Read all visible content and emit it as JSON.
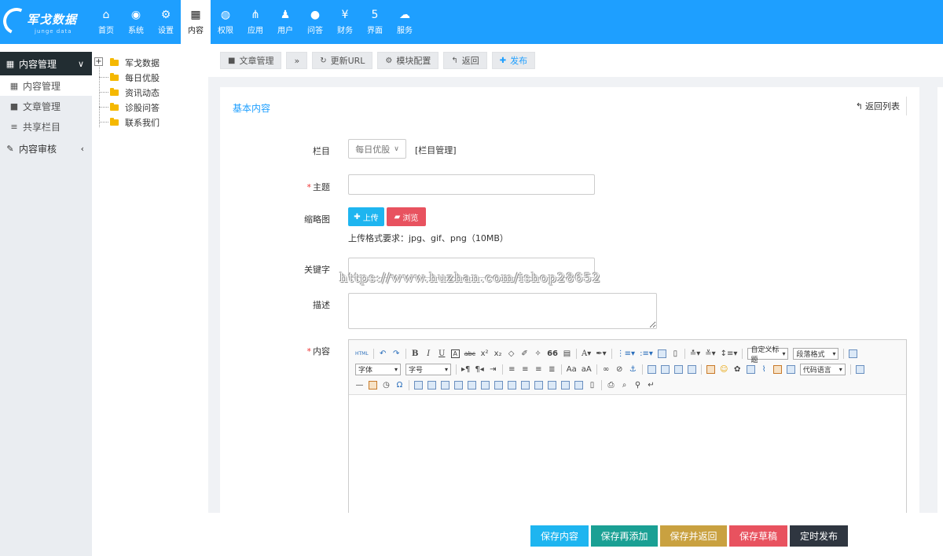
{
  "logo": {
    "title": "军戈数据",
    "subtitle": "junge data"
  },
  "nav": [
    {
      "label": "首页",
      "icon": "home-icon",
      "glyph": "⌂"
    },
    {
      "label": "系统",
      "icon": "globe-icon",
      "glyph": "◉"
    },
    {
      "label": "设置",
      "icon": "gears-icon",
      "glyph": "⚙"
    },
    {
      "label": "内容",
      "icon": "grid-icon",
      "glyph": "▦",
      "active": true
    },
    {
      "label": "权限",
      "icon": "user-circle-icon",
      "glyph": "◍"
    },
    {
      "label": "应用",
      "icon": "sitemap-icon",
      "glyph": "⋔"
    },
    {
      "label": "用户",
      "icon": "user-icon",
      "glyph": "♟"
    },
    {
      "label": "问答",
      "icon": "chat-icon",
      "glyph": "●"
    },
    {
      "label": "财务",
      "icon": "yen-icon",
      "glyph": "¥"
    },
    {
      "label": "界面",
      "icon": "html5-icon",
      "glyph": "5"
    },
    {
      "label": "服务",
      "icon": "cloud-icon",
      "glyph": "☁"
    }
  ],
  "sidebar": {
    "groups": [
      {
        "label": "内容管理",
        "icon": "grid-icon",
        "glyph": "▦",
        "arrow": "∨",
        "active": true
      },
      {
        "label": "内容审核",
        "icon": "edit-icon",
        "glyph": "✎",
        "arrow": "‹"
      }
    ],
    "items": [
      {
        "label": "内容管理",
        "icon": "grid-icon",
        "glyph": "▦",
        "active": true
      },
      {
        "label": "文章管理",
        "icon": "note-icon",
        "glyph": "■"
      },
      {
        "label": "共享栏目",
        "icon": "list-icon",
        "glyph": "≡"
      }
    ]
  },
  "tree": {
    "expander": "+",
    "root": "军戈数据",
    "children": [
      "每日优股",
      "资讯动态",
      "诊股问答",
      "联系我们"
    ]
  },
  "toolbar": {
    "article_manage": "文章管理",
    "more": "»",
    "refresh_url": "更新URL",
    "module_config": "模块配置",
    "back": "返回",
    "publish": "发布"
  },
  "panel": {
    "title": "基本内容",
    "back_list": "返回列表"
  },
  "form": {
    "column_label": "栏目",
    "column_value": "每日优股",
    "column_link": "[栏目管理]",
    "subject_label": "主题",
    "subject_value": "",
    "thumbnail_label": "缩略图",
    "upload_label": "上传",
    "browse_label": "浏览",
    "upload_hint": "上传格式要求：jpg、gif、png（10MB）",
    "keywords_label": "关键字",
    "keywords_value": "",
    "description_label": "描述",
    "description_value": "",
    "content_label": "内容",
    "required_mark": "*"
  },
  "watermark": "https://www.huzhan.com/ishop28652",
  "editor": {
    "html_btn": "HTML",
    "custom_title": "自定义标题",
    "paragraph_format": "段落格式",
    "font_family": "字体",
    "font_size": "字号",
    "code_language": "代码语言"
  },
  "footer": {
    "save": "保存内容",
    "save_add": "保存再添加",
    "save_return": "保存并返回",
    "save_draft": "保存草稿",
    "schedule": "定时发布",
    "colors": {
      "save": "#1eb5f0",
      "save_add": "#1aa094",
      "save_return": "#c9a140",
      "save_draft": "#e8525f",
      "schedule": "#2f3640"
    }
  },
  "colors": {
    "accent": "#1e9fff",
    "sidebar_dark": "#222d32"
  }
}
